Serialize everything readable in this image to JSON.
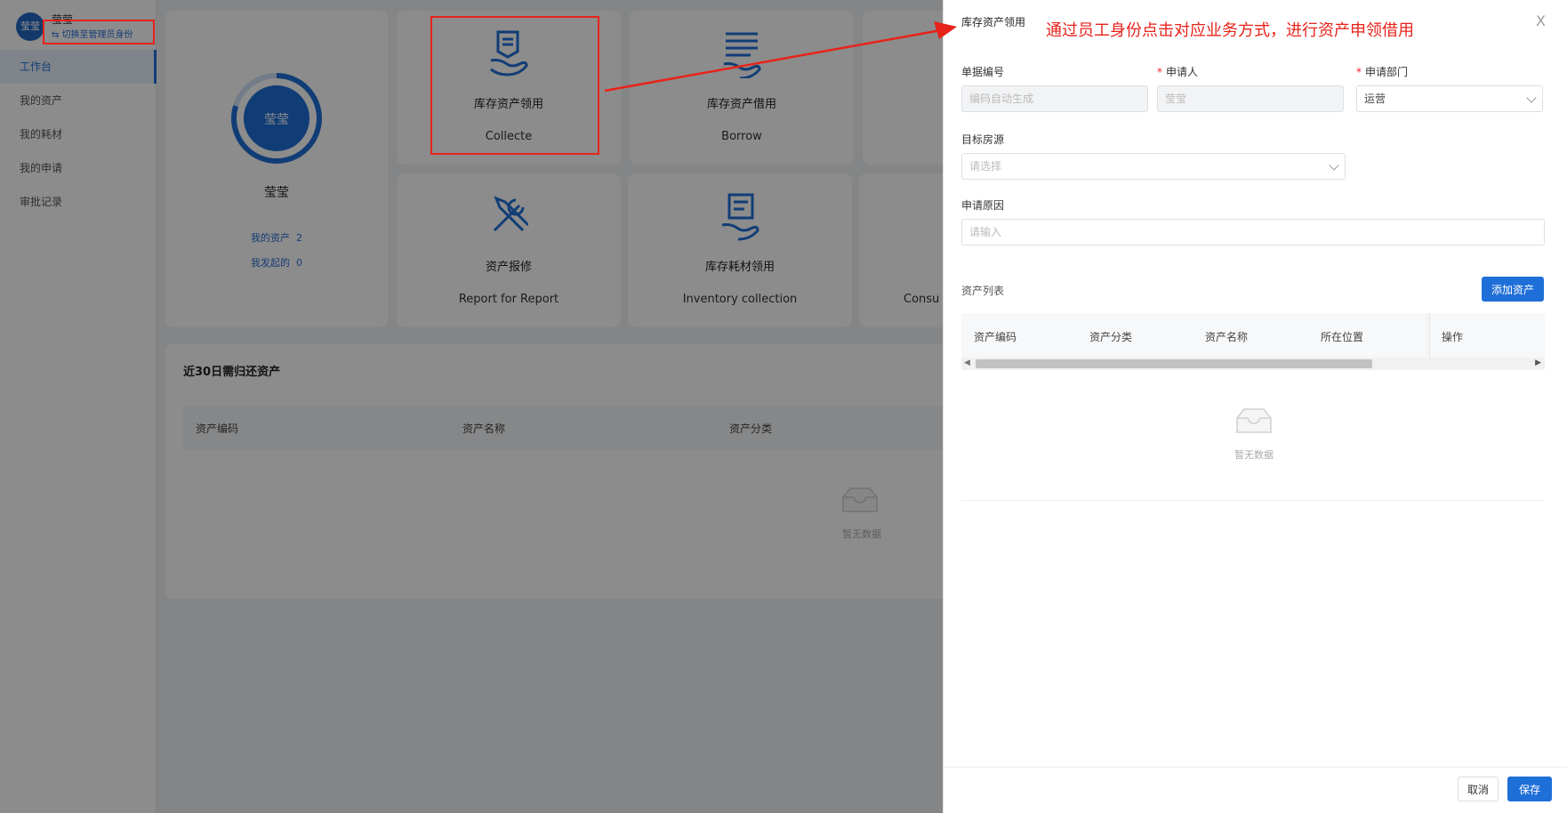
{
  "sidebar": {
    "avatar_text": "莹莹",
    "user_name": "莹莹",
    "switch_role": "⇆ 切换至管理员身份",
    "items": [
      {
        "label": "工作台"
      },
      {
        "label": "我的资产"
      },
      {
        "label": "我的耗材"
      },
      {
        "label": "我的申请"
      },
      {
        "label": "审批记录"
      }
    ]
  },
  "profile": {
    "ring_label": "莹莹",
    "name": "莹莹",
    "my_assets_label": "我的资产",
    "my_assets_count": "2",
    "initiated_label": "我发起的",
    "initiated_count": "0"
  },
  "biz_cards": [
    {
      "title": "库存资产领用",
      "subtitle": "Collecte"
    },
    {
      "title": "库存资产借用",
      "subtitle": "Borrow"
    },
    {
      "title": "资产报修",
      "subtitle": "Report for Report"
    },
    {
      "title": "库存耗材领用",
      "subtitle": "Inventory collection"
    },
    {
      "title": "",
      "subtitle": "Consu"
    }
  ],
  "return_section": {
    "title": "近30日需归还资产",
    "columns": [
      "资产编码",
      "资产名称",
      "资产分类"
    ],
    "empty_text": "暂无数据"
  },
  "drawer": {
    "title": "库存资产领用",
    "close": "X",
    "fields": {
      "doc_no": {
        "label": "单据编号",
        "placeholder": "编码自动生成"
      },
      "applicant": {
        "label": "申请人",
        "value": "莹莹"
      },
      "department": {
        "label": "申请部门",
        "value": "运营"
      },
      "target_room": {
        "label": "目标房源",
        "placeholder": "请选择"
      },
      "reason": {
        "label": "申请原因",
        "placeholder": "请输入"
      }
    },
    "asset_list_label": "资产列表",
    "add_asset_label": "添加资产",
    "table_columns": [
      "资产编码",
      "资产分类",
      "资产名称",
      "所在位置",
      "操作"
    ],
    "empty_text": "暂无数据",
    "cancel_label": "取消",
    "save_label": "保存"
  },
  "annotation": {
    "text": "通过员工身份点击对应业务方式，进行资产申领借用",
    "color": "#e8231b"
  },
  "colors": {
    "primary": "#1f6fd8",
    "annotation": "#e8231b"
  }
}
